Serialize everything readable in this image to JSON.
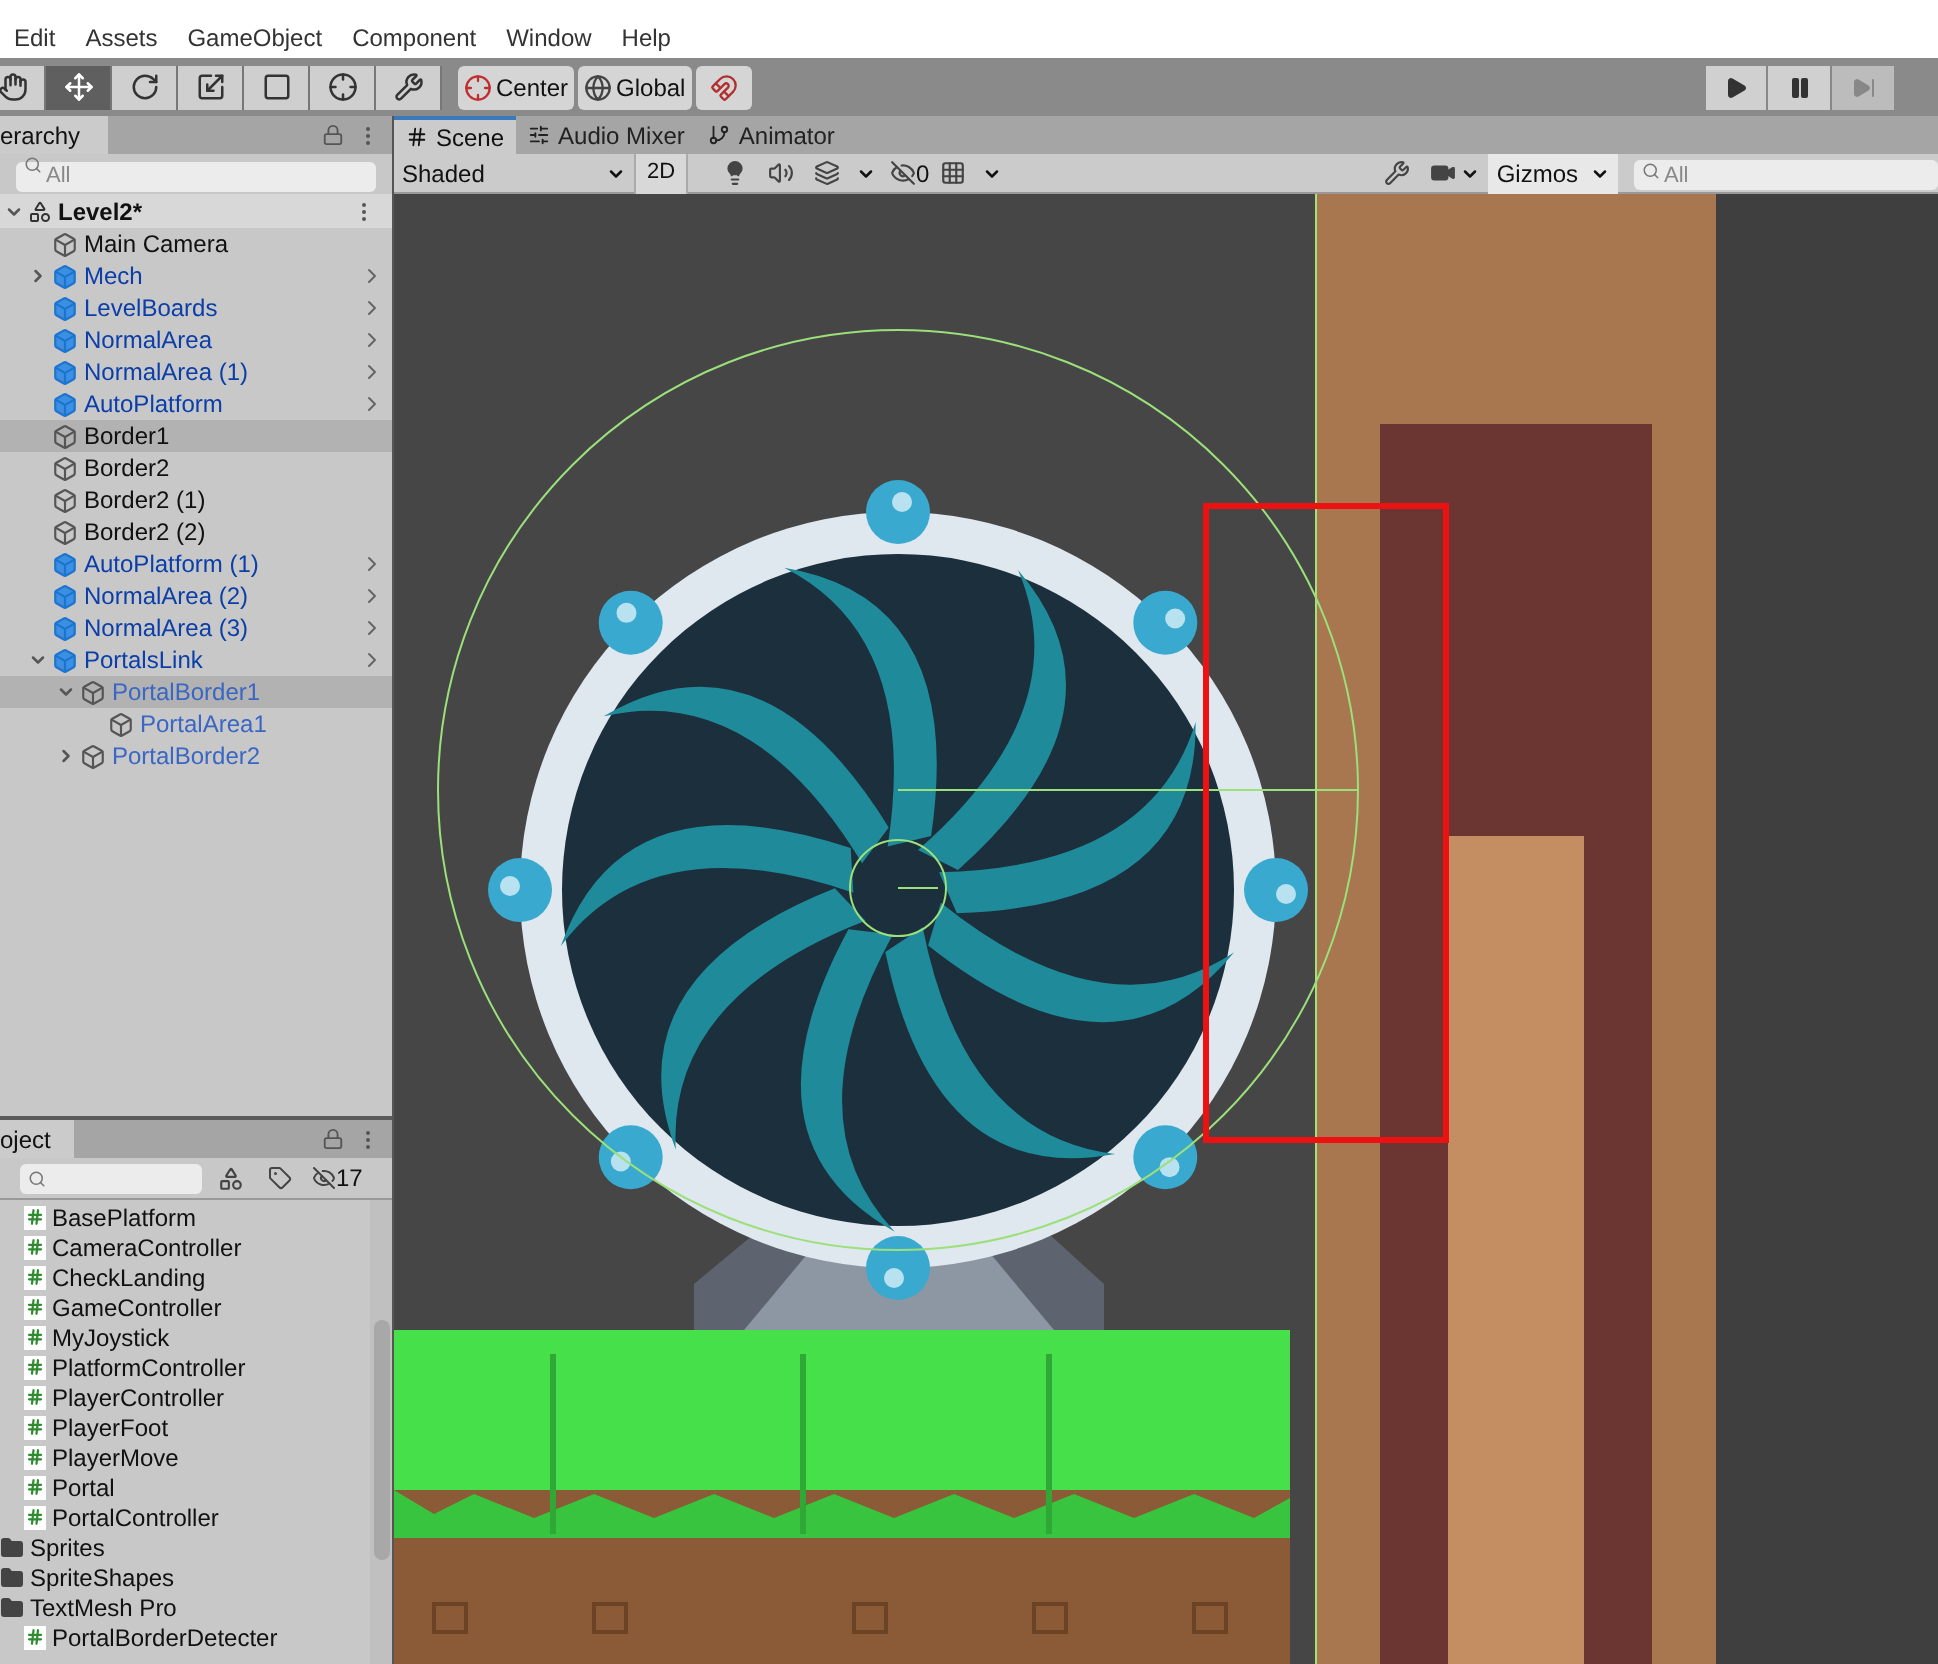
{
  "menu": [
    "Edit",
    "Assets",
    "GameObject",
    "Component",
    "Window",
    "Help"
  ],
  "toolbar": {
    "tools": [
      {
        "kind": "hand",
        "selected": false
      },
      {
        "kind": "move",
        "selected": true
      },
      {
        "kind": "rotate",
        "selected": false
      },
      {
        "kind": "scale",
        "selected": false
      },
      {
        "kind": "rect",
        "selected": false
      },
      {
        "kind": "transform",
        "selected": false
      },
      {
        "kind": "custom",
        "selected": false
      }
    ],
    "pivot": "Center",
    "space": "Global"
  },
  "hierarchy": {
    "tab": "erarchy",
    "search_placeholder": "All",
    "scene": {
      "name": "Level2*",
      "expanded": true,
      "children": [
        {
          "name": "Main Camera",
          "kind": "object",
          "selected": false
        },
        {
          "name": "Mech",
          "kind": "prefab",
          "selected": false,
          "expanded": false
        },
        {
          "name": "LevelBoards",
          "kind": "prefab",
          "selected": false
        },
        {
          "name": "NormalArea",
          "kind": "prefab",
          "selected": false
        },
        {
          "name": "NormalArea (1)",
          "kind": "prefab",
          "selected": false
        },
        {
          "name": "AutoPlatform",
          "kind": "prefab",
          "selected": false
        },
        {
          "name": "Border1",
          "kind": "object",
          "selected": true
        },
        {
          "name": "Border2",
          "kind": "object",
          "selected": false
        },
        {
          "name": "Border2 (1)",
          "kind": "object",
          "selected": false
        },
        {
          "name": "Border2 (2)",
          "kind": "object",
          "selected": false
        },
        {
          "name": "AutoPlatform (1)",
          "kind": "prefab",
          "selected": false
        },
        {
          "name": "NormalArea (2)",
          "kind": "prefab",
          "selected": false
        },
        {
          "name": "NormalArea (3)",
          "kind": "prefab",
          "selected": false
        },
        {
          "name": "PortalsLink",
          "kind": "prefab",
          "selected": false,
          "expanded": true,
          "children": [
            {
              "name": "PortalBorder1",
              "kind": "nested",
              "selected": true,
              "expanded": true,
              "children": [
                {
                  "name": "PortalArea1",
                  "kind": "nested",
                  "selected": false
                }
              ]
            },
            {
              "name": "PortalBorder2",
              "kind": "nested",
              "selected": false,
              "expanded": false
            }
          ]
        }
      ]
    }
  },
  "project": {
    "tab": "oject",
    "hidden_count": "17",
    "items": [
      {
        "name": "BasePlatform",
        "kind": "script"
      },
      {
        "name": "CameraController",
        "kind": "script"
      },
      {
        "name": "CheckLanding",
        "kind": "script"
      },
      {
        "name": "GameController",
        "kind": "script"
      },
      {
        "name": "MyJoystick",
        "kind": "script"
      },
      {
        "name": "PlatformController",
        "kind": "script"
      },
      {
        "name": "PlayerController",
        "kind": "script"
      },
      {
        "name": "PlayerFoot",
        "kind": "script"
      },
      {
        "name": "PlayerMove",
        "kind": "script"
      },
      {
        "name": "Portal",
        "kind": "script"
      },
      {
        "name": "PortalController",
        "kind": "script"
      },
      {
        "name": "Sprites",
        "kind": "folder"
      },
      {
        "name": "SpriteShapes",
        "kind": "folder"
      },
      {
        "name": "TextMesh Pro",
        "kind": "folder"
      },
      {
        "name": "PortalBorderDetecter",
        "kind": "script"
      }
    ]
  },
  "scene_view": {
    "tabs": [
      {
        "label": "Scene",
        "kind": "scene",
        "selected": true
      },
      {
        "label": "Audio Mixer",
        "kind": "mixer",
        "selected": false
      },
      {
        "label": "Animator",
        "kind": "animator",
        "selected": false
      }
    ],
    "draw_mode": "Shaded",
    "mode_2d": {
      "label": "2D",
      "selected": true
    },
    "hidden_count": "0",
    "gizmos": "Gizmos",
    "search_placeholder": "All"
  }
}
